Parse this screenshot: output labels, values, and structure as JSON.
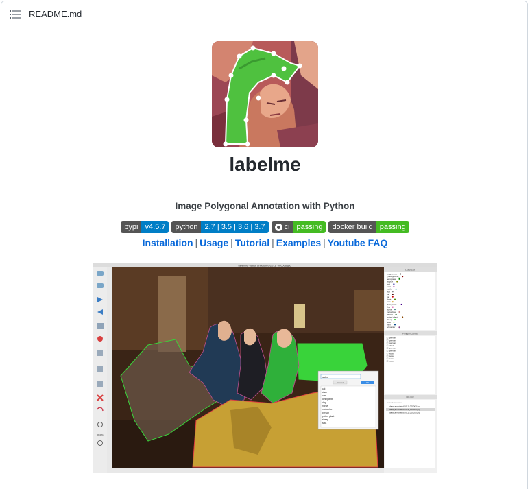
{
  "file_header": {
    "icon": "list-icon",
    "file_name": "README.md"
  },
  "readme": {
    "title": "labelme",
    "subtitle": "Image Polygonal Annotation with Python",
    "badges": [
      {
        "label": "pypi",
        "value": "v4.5.7",
        "color": "#007ec6",
        "icon": ""
      },
      {
        "label": "python",
        "value": "2.7 | 3.5 | 3.6 | 3.7",
        "color": "#007ec6",
        "icon": ""
      },
      {
        "label": "ci",
        "value": "passing",
        "color": "#4c1",
        "icon": "github-icon"
      },
      {
        "label": "docker build",
        "value": "passing",
        "color": "#4c1",
        "icon": ""
      }
    ],
    "links": [
      "Installation",
      "Usage",
      "Tutorial",
      "Examples",
      "Youtube FAQ"
    ],
    "link_separator": "|"
  },
  "screenshot": {
    "window_title": "labelme - data_annotated/2011_000006.jpg",
    "toolbar_items": [
      "Open",
      "Open Dir",
      "Next Image",
      "Prev Image",
      "Save",
      "Delete File",
      "Create Polygons",
      "Edit Polygons",
      "Duplicate Polygons",
      "Delete Polygons",
      "Undo",
      "Zoom In",
      "Zoom Out",
      "Fit Window"
    ],
    "zoom_level": "29.0 %",
    "panels": {
      "label_list": "Label List",
      "polygon_labels": "Polygon Labels",
      "file_list": "File List"
    },
    "label_list": [
      "__ignore__",
      "_background_",
      "aeroplane",
      "bicycle",
      "bird",
      "boat",
      "bottle",
      "bus",
      "car",
      "cat",
      "chair",
      "cow",
      "diningtable",
      "dog",
      "horse",
      "motorbike",
      "person",
      "potted plant",
      "sheep",
      "sofa",
      "train",
      "tvmonitor"
    ],
    "polygon_labels": [
      "person",
      "person",
      "person",
      "chair",
      "person",
      "person",
      "sofa",
      "sofa",
      "sofa",
      "sofa"
    ],
    "file_search_placeholder": "Search Filename",
    "file_list": [
      "data_annotated/2011_000003.jpg",
      "data_annotated/2011_000006.jpg",
      "data_annotated/2011_000025.jpg"
    ],
    "dialog": {
      "input_value": "sofa",
      "cancel_label": "Cancel",
      "ok_label": "OK",
      "options": [
        "cat",
        "chair",
        "cow",
        "diningtable",
        "dog",
        "horse",
        "motorbike",
        "person",
        "potted plant",
        "sheep",
        "sofa"
      ]
    }
  }
}
